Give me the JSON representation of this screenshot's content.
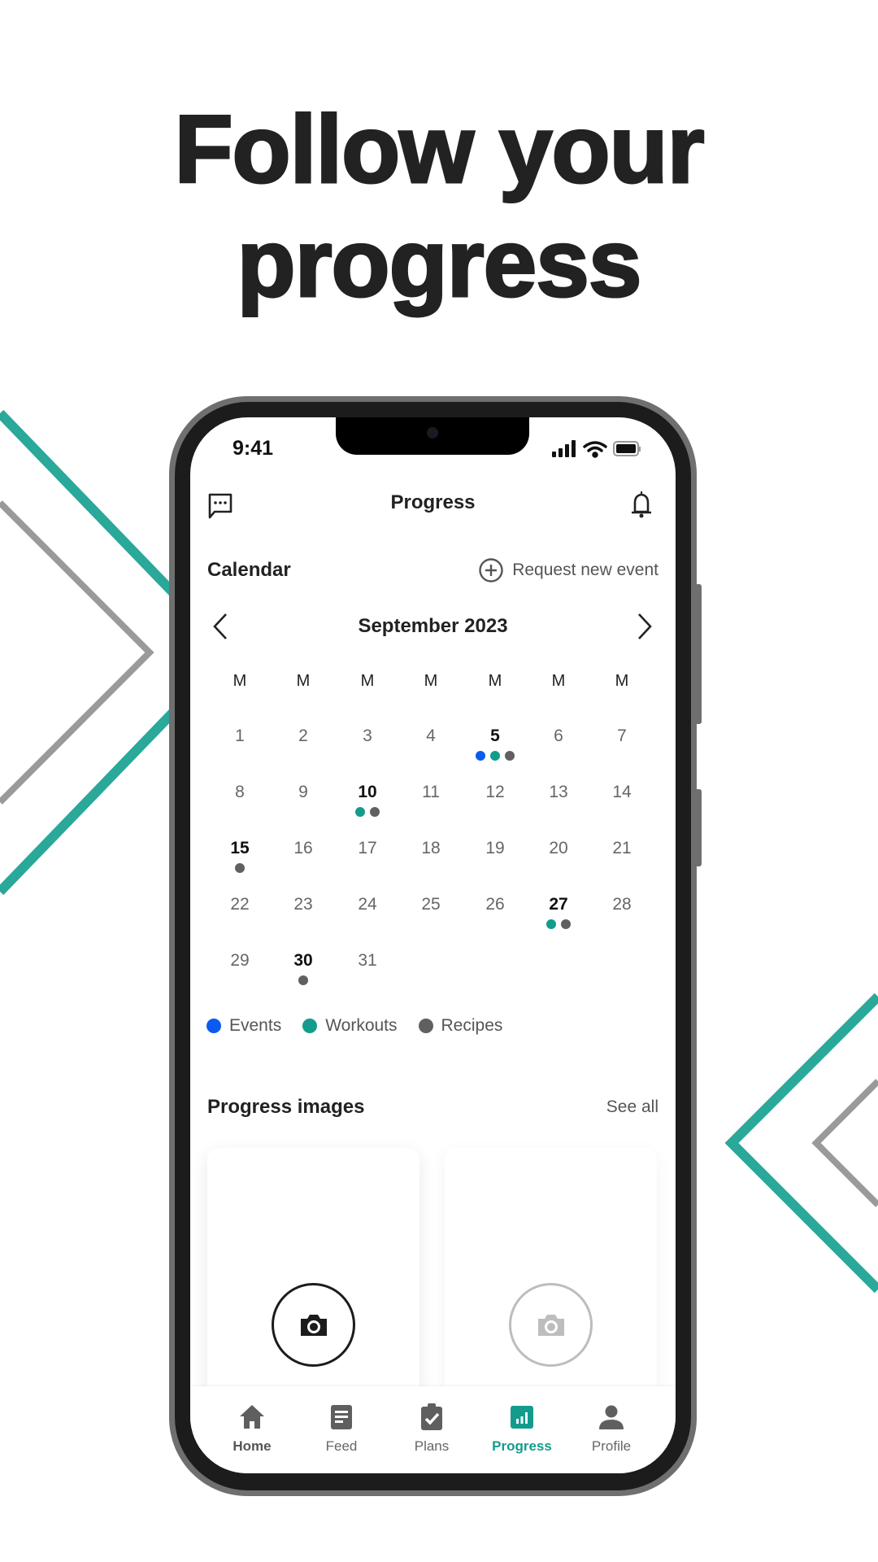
{
  "headline": {
    "line1": "Follow your",
    "line2": "progress"
  },
  "colors": {
    "accent": "#139c8c",
    "events": "#0a5cf0",
    "workouts": "#139c8c",
    "recipes": "#606060",
    "deco_teal": "#2aa89a",
    "deco_gray": "#9a9a9a"
  },
  "status_bar": {
    "time": "9:41",
    "icons": [
      "cellular-signal-icon",
      "wifi-icon",
      "battery-icon"
    ]
  },
  "header": {
    "title": "Progress",
    "left_icon": "chat-icon",
    "right_icon": "bell-icon"
  },
  "calendar": {
    "title": "Calendar",
    "request_label": "Request new event",
    "month": "September 2023",
    "weekdays": [
      "M",
      "M",
      "M",
      "M",
      "M",
      "M",
      "M"
    ],
    "days": [
      {
        "d": "1"
      },
      {
        "d": "2"
      },
      {
        "d": "3"
      },
      {
        "d": "4"
      },
      {
        "d": "5",
        "marks": [
          "events",
          "workouts",
          "recipes"
        ]
      },
      {
        "d": "6"
      },
      {
        "d": "7"
      },
      {
        "d": "8"
      },
      {
        "d": "9"
      },
      {
        "d": "10",
        "marks": [
          "workouts",
          "recipes"
        ]
      },
      {
        "d": "11"
      },
      {
        "d": "12"
      },
      {
        "d": "13"
      },
      {
        "d": "14"
      },
      {
        "d": "15",
        "marks": [
          "recipes"
        ]
      },
      {
        "d": "16"
      },
      {
        "d": "17"
      },
      {
        "d": "18"
      },
      {
        "d": "19"
      },
      {
        "d": "20"
      },
      {
        "d": "21"
      },
      {
        "d": "22"
      },
      {
        "d": "23"
      },
      {
        "d": "24"
      },
      {
        "d": "25"
      },
      {
        "d": "26"
      },
      {
        "d": "27",
        "marks": [
          "workouts",
          "recipes"
        ]
      },
      {
        "d": "28"
      },
      {
        "d": "29"
      },
      {
        "d": "30",
        "marks": [
          "recipes"
        ]
      },
      {
        "d": "31"
      }
    ],
    "legend": [
      {
        "key": "events",
        "label": "Events"
      },
      {
        "key": "workouts",
        "label": "Workouts"
      },
      {
        "key": "recipes",
        "label": "Recipes"
      }
    ]
  },
  "progress_images": {
    "title": "Progress images",
    "see_all": "See all"
  },
  "tabs": [
    {
      "label": "Home",
      "icon": "home-icon"
    },
    {
      "label": "Feed",
      "icon": "feed-icon"
    },
    {
      "label": "Plans",
      "icon": "clipboard-check-icon"
    },
    {
      "label": "Progress",
      "icon": "chart-icon",
      "active": true
    },
    {
      "label": "Profile",
      "icon": "person-icon"
    }
  ]
}
